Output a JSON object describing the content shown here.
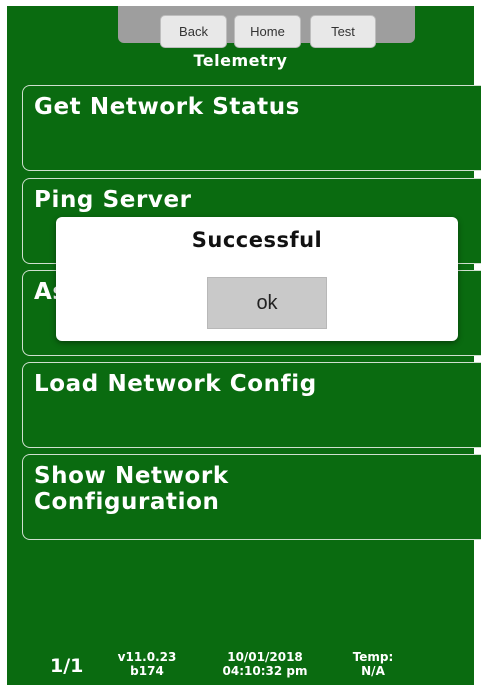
{
  "nav": {
    "back": "Back",
    "home": "Home",
    "test": "Test"
  },
  "screen_title": "Telemetry",
  "menu": [
    {
      "label": "Get Network Status"
    },
    {
      "label": "Ping Server"
    },
    {
      "label": "As"
    },
    {
      "label": "Load Network Config"
    },
    {
      "label": "Show Network\nConfiguration"
    }
  ],
  "dialog": {
    "message": "Successful",
    "ok_label": "ok"
  },
  "footer": {
    "page": "1/1",
    "version": "v11.0.23",
    "build": "b174",
    "date": "10/01/2018",
    "time": "04:10:32 pm",
    "temp_label": "Temp:",
    "temp_value": "N/A"
  },
  "colors": {
    "screen_bg": "#0a6b10",
    "text": "#ffffff",
    "dialog_bg": "#ffffff"
  }
}
